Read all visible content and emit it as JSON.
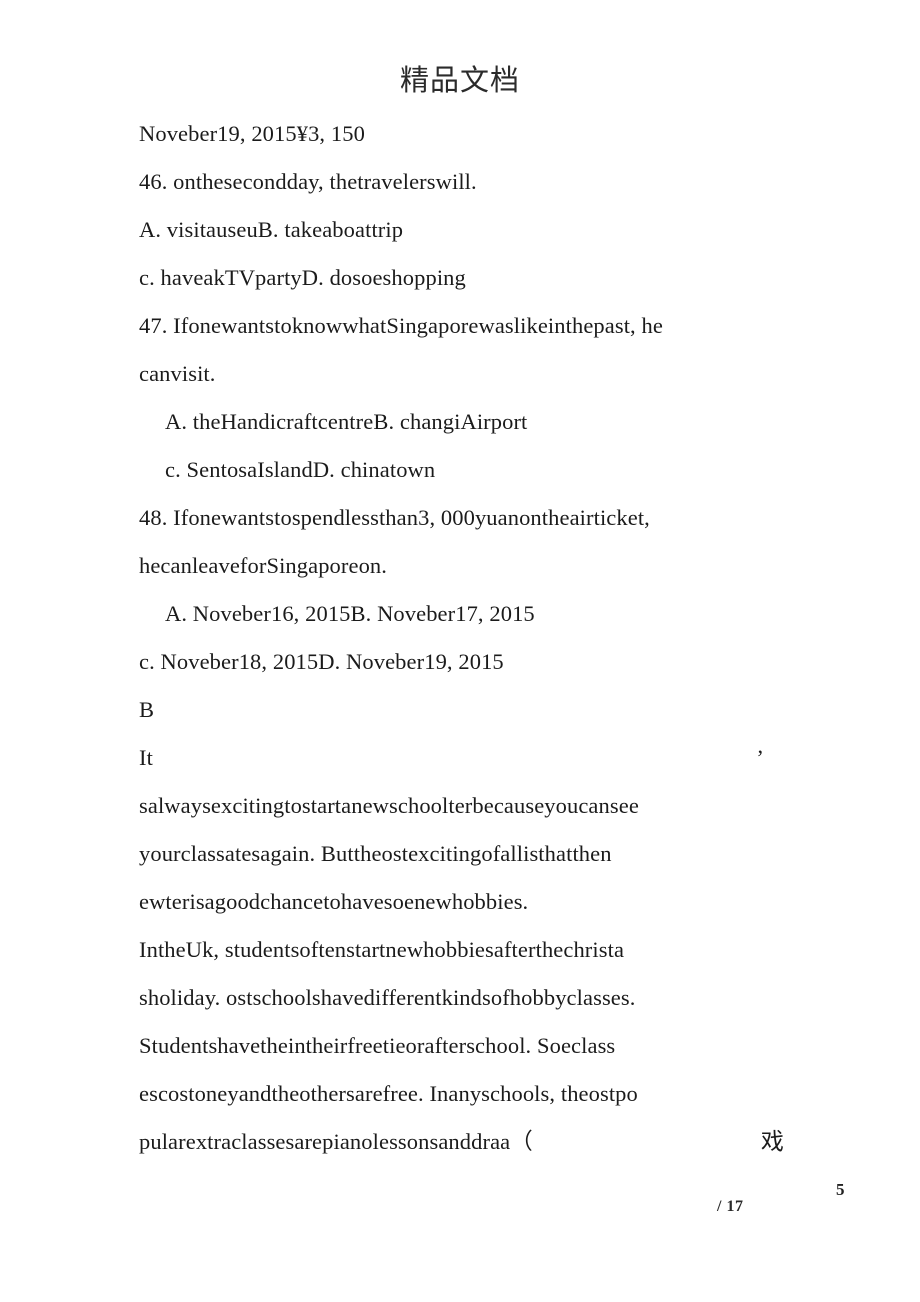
{
  "header": {
    "watermark": "精品文档"
  },
  "document": {
    "lines": [
      {
        "id": "line-price",
        "text": "Noveber19, 2015¥3, 150",
        "indent": false
      },
      {
        "id": "q46-stem",
        "text": "46. onthesecondday, thetravelerswill.",
        "indent": false
      },
      {
        "id": "q46-options-ab",
        "text": "A. visitauseuB. takeaboattrip",
        "indent": false
      },
      {
        "id": "q46-options-cd",
        "text": "c. haveakTVpartyD. dosoeshopping",
        "indent": false
      },
      {
        "id": "q47-stem-1",
        "text": "47. IfonewantstoknowwhatSingaporewaslikeinthepast, he",
        "indent": false
      },
      {
        "id": "q47-stem-2",
        "text": "canvisit.",
        "indent": false
      },
      {
        "id": "q47-options-ab",
        "text": "A. theHandicraftcentreB. changiAirport",
        "indent": true
      },
      {
        "id": "q47-options-cd",
        "text": "c. SentosaIslandD. chinatown",
        "indent": true
      },
      {
        "id": "q48-stem-1",
        "text": "48. Ifonewantstospendlessthan3, 000yuanontheairticket,",
        "indent": false
      },
      {
        "id": "q48-stem-2",
        "text": "hecanleaveforSingaporeon.",
        "indent": false
      },
      {
        "id": "q48-options-ab",
        "text": "A. Noveber16, 2015B. Noveber17, 2015",
        "indent": true
      },
      {
        "id": "q48-options-cd",
        "text": "c. Noveber18, 2015D. Noveber19, 2015",
        "indent": false
      },
      {
        "id": "section-b-label",
        "text": "B",
        "indent": false
      }
    ],
    "split_line": {
      "id": "passage-line-it",
      "lead": "It",
      "tail": "’"
    },
    "passage_lines": [
      {
        "id": "passage-l1",
        "text": "salwaysexcitingtostartanewschoolterbecauseyoucansee"
      },
      {
        "id": "passage-l2",
        "text": "yourclassatesagain. Buttheostexcitingofallisthatthen"
      },
      {
        "id": "passage-l3",
        "text": "ewterisagoodchancetohavesoenewhobbies."
      },
      {
        "id": "passage-l4",
        "text": "IntheUk, studentsoftenstartnewhobbiesafterthechrista"
      },
      {
        "id": "passage-l5",
        "text": "sholiday. ostschoolshavedifferentkindsofhobbyclasses."
      },
      {
        "id": "passage-l6",
        "text": "Studentshavetheintheirfreetieorafterschool. Soeclass"
      },
      {
        "id": "passage-l7",
        "text": "escostoneyandtheothersarefree. Inanyschools, theostpo"
      }
    ],
    "final_line": {
      "id": "passage-final",
      "lead": "pularextraclassesarepianolessonsanddraa（",
      "tail": "戏"
    }
  },
  "footer": {
    "page_number": "5",
    "page_total": "/ 17"
  }
}
